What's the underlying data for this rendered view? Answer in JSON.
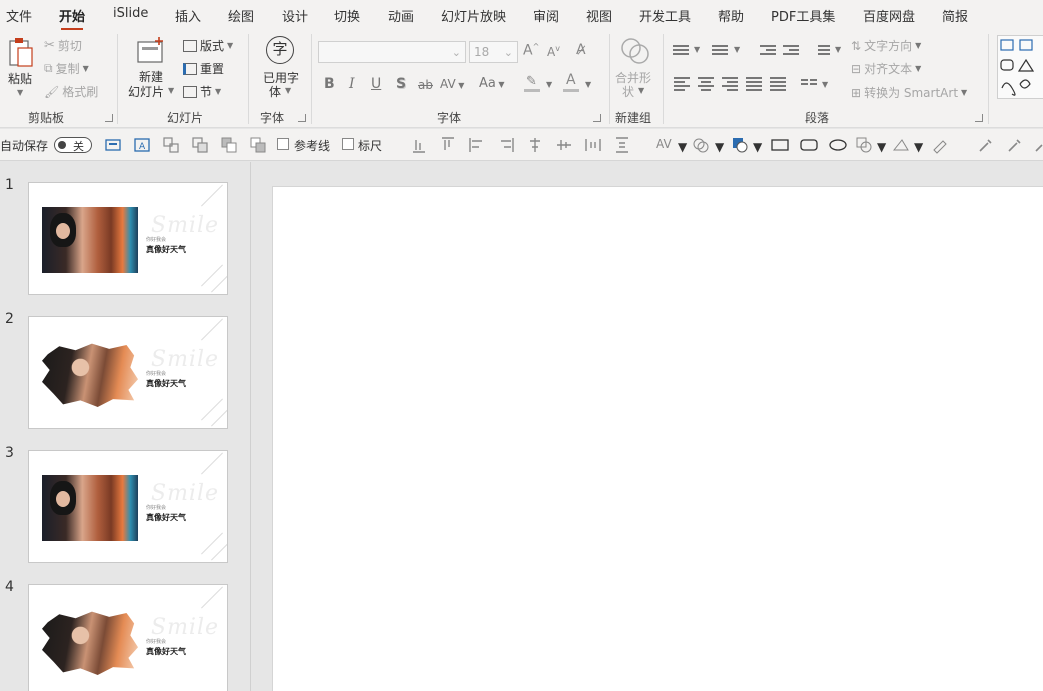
{
  "menu": {
    "tabs": [
      "文件",
      "开始",
      "iSlide",
      "插入",
      "绘图",
      "设计",
      "切换",
      "动画",
      "幻灯片放映",
      "审阅",
      "视图",
      "开发工具",
      "帮助",
      "PDF工具集",
      "百度网盘",
      "简报"
    ],
    "active": "开始"
  },
  "ribbon": {
    "clipboard": {
      "paste": "粘贴",
      "cut": "剪切",
      "copy": "复制",
      "format_painter": "格式刷",
      "label": "剪贴板"
    },
    "slides": {
      "new_slide_line1": "新建",
      "new_slide_line2": "幻灯片",
      "layout": "版式",
      "reset": "重置",
      "section": "节",
      "label": "幻灯片"
    },
    "fonts": {
      "used_fonts_line1": "已用字",
      "used_fonts_line2": "体",
      "label": "字体",
      "glyph": "字"
    },
    "font": {
      "font_name": "",
      "font_size": "18",
      "label": "字体",
      "bold": "B",
      "italic": "I",
      "underline": "U",
      "shadow": "S",
      "strike": "ab",
      "spacing": "AV",
      "case": "Aa",
      "font_color_letter": "A"
    },
    "new_group": {
      "merge_line1": "合并形",
      "merge_line2": "状",
      "label": "新建组"
    },
    "paragraph": {
      "text_direction": "文字方向",
      "align_text": "对齐文本",
      "smartart": "转换为 SmartArt",
      "label": "段落"
    }
  },
  "quickbar": {
    "autosave": "自动保存",
    "toggle_state": "关",
    "guides": "参考线",
    "ruler": "标尺"
  },
  "slides": [
    {
      "number": "1",
      "style": "rect",
      "watermark": "Smile",
      "subtitle": "你好我会",
      "title": "真像好天气"
    },
    {
      "number": "2",
      "style": "brush",
      "watermark": "Smile",
      "subtitle": "你好我会",
      "title": "真像好天气"
    },
    {
      "number": "3",
      "style": "rect",
      "watermark": "Smile",
      "subtitle": "你好我会",
      "title": "真像好天气"
    },
    {
      "number": "4",
      "style": "brush",
      "watermark": "Smile",
      "subtitle": "你好我会",
      "title": "真像好天气"
    }
  ],
  "colors": {
    "accent": "#c43e1c",
    "ribbon_bg": "#f3f2f1",
    "workspace_bg": "#e6e6e6"
  }
}
